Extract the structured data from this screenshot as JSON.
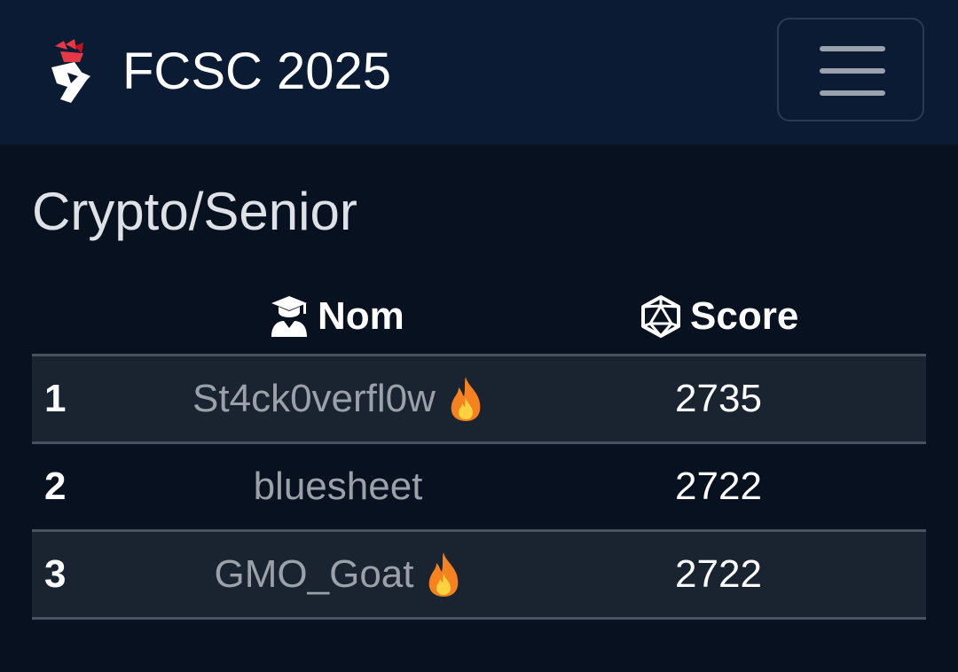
{
  "header": {
    "title": "FCSC 2025",
    "logo_icon": "fcsc-rooster-logo-icon",
    "menu_icon": "hamburger-menu-icon"
  },
  "section": {
    "title": "Crypto/Senior"
  },
  "table": {
    "columns": [
      {
        "label": "Nom",
        "icon": "user-graduate-icon"
      },
      {
        "label": "Score",
        "icon": "d20-dice-icon"
      }
    ],
    "rows": [
      {
        "rank": "1",
        "name": "St4ck0verfl0w",
        "score": "2735",
        "flame": true
      },
      {
        "rank": "2",
        "name": "bluesheet",
        "score": "2722",
        "flame": false
      },
      {
        "rank": "3",
        "name": "GMO_Goat",
        "score": "2722",
        "flame": true
      }
    ]
  },
  "colors": {
    "background": "#07111f",
    "navbar": "#0b1b33",
    "row_striped": "#1a2330",
    "name_text": "#9aa1a9",
    "flame_orange": "#f5821f",
    "logo_red": "#e63946"
  }
}
